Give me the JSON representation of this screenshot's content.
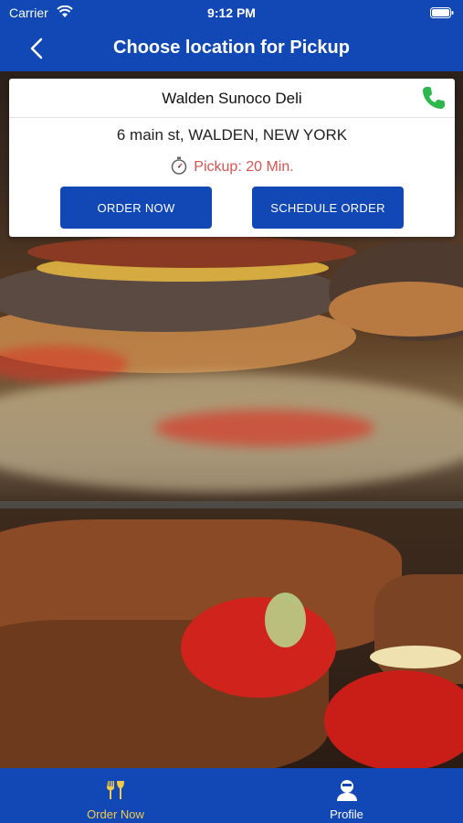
{
  "status_bar": {
    "carrier": "Carrier",
    "time": "9:12 PM"
  },
  "nav": {
    "title": "Choose location for Pickup",
    "back_icon": "chevron-left-icon"
  },
  "location": {
    "name": "Walden Sunoco Deli",
    "address": "6 main st, WALDEN, NEW YORK",
    "pickup_text": "Pickup: 20 Min.",
    "order_now_label": "ORDER NOW",
    "schedule_label": "SCHEDULE ORDER"
  },
  "tabs": [
    {
      "label": "Order Now",
      "icon": "utensils-icon",
      "active": true
    },
    {
      "label": "Profile",
      "icon": "user-icon",
      "active": false
    }
  ],
  "colors": {
    "brand_blue": "#1148b5",
    "active_tab": "#f2c94c",
    "pickup_red": "#d9544f",
    "phone_green": "#2db84d"
  }
}
